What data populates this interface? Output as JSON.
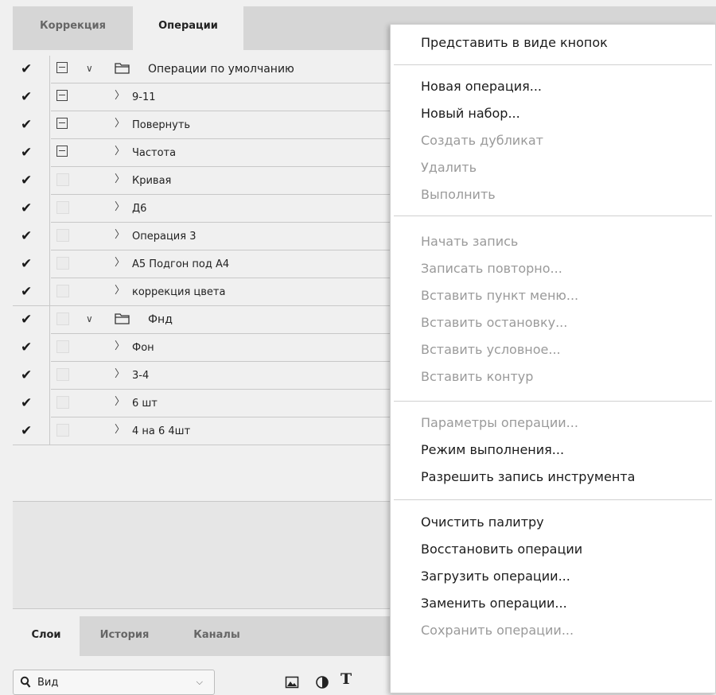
{
  "actions_panel": {
    "tabs": [
      "Коррекция",
      "Операции"
    ],
    "active_tab": 1,
    "sets": [
      {
        "name": "Операции по умолчанию",
        "expanded": true,
        "actions": [
          "9-11",
          "Повернуть",
          "Частота",
          "Кривая",
          "Д6",
          "Операция 3",
          "А5 Подгон под А4",
          "коррекция цвета"
        ]
      },
      {
        "name": "Фнд",
        "expanded": true,
        "actions": [
          "Фон",
          "3-4",
          "6 шт",
          "4 на 6 4шт"
        ]
      }
    ],
    "rows": [
      {
        "label": "Операции по умолчанию",
        "type": "set",
        "check": "✔",
        "dialog": true
      },
      {
        "label": "9-11",
        "type": "action",
        "check": "✔",
        "dialog": true
      },
      {
        "label": "Повернуть",
        "type": "action",
        "check": "✔",
        "dialog": true
      },
      {
        "label": "Частота",
        "type": "action",
        "check": "✔",
        "dialog": true
      },
      {
        "label": "Кривая",
        "type": "action",
        "check": "✔",
        "dialog": false
      },
      {
        "label": "Д6",
        "type": "action",
        "check": "✔",
        "dialog": false
      },
      {
        "label": "Операция 3",
        "type": "action",
        "check": "✔",
        "dialog": false
      },
      {
        "label": "А5 Подгон под А4",
        "type": "action",
        "check": "✔",
        "dialog": false
      },
      {
        "label": "коррекция цвета",
        "type": "action",
        "check": "✔",
        "dialog": false
      },
      {
        "label": "Фнд",
        "type": "set",
        "check": "✔",
        "dialog": false
      },
      {
        "label": "Фон",
        "type": "action",
        "check": "✔",
        "dialog": false
      },
      {
        "label": "3-4",
        "type": "action",
        "check": "✔",
        "dialog": false
      },
      {
        "label": "6 шт",
        "type": "action",
        "check": "✔",
        "dialog": false
      },
      {
        "label": "4 на 6 4шт",
        "type": "action",
        "check": "✔",
        "dialog": false
      }
    ]
  },
  "layers_panel": {
    "tabs": [
      "Слои",
      "История",
      "Каналы"
    ],
    "active_tab": 0,
    "filter": {
      "icon": "search-icon",
      "label": "Вид",
      "dropdown": "⌵"
    },
    "filter_icons": [
      "image-filter-icon",
      "adjustment-filter-icon",
      "type-filter-icon"
    ],
    "type_glyph": "T"
  },
  "context_menu": {
    "items": [
      {
        "label": "Представить в виде кнопок",
        "enabled": true
      },
      {
        "label": "Новая операция...",
        "enabled": true
      },
      {
        "label": "Новый набор...",
        "enabled": true
      },
      {
        "label": "Создать дубликат",
        "enabled": false
      },
      {
        "label": "Удалить",
        "enabled": false
      },
      {
        "label": "Выполнить",
        "enabled": false
      },
      {
        "label": "Начать запись",
        "enabled": false
      },
      {
        "label": "Записать повторно...",
        "enabled": false
      },
      {
        "label": "Вставить пункт меню...",
        "enabled": false
      },
      {
        "label": "Вставить остановку...",
        "enabled": false
      },
      {
        "label": "Вставить условное...",
        "enabled": false
      },
      {
        "label": "Вставить контур",
        "enabled": false
      },
      {
        "label": "Параметры операции...",
        "enabled": false
      },
      {
        "label": "Режим выполнения...",
        "enabled": true
      },
      {
        "label": "Разрешить запись инструмента",
        "enabled": true
      },
      {
        "label": "Очистить палитру",
        "enabled": true
      },
      {
        "label": "Восстановить операции",
        "enabled": true
      },
      {
        "label": "Загрузить операции...",
        "enabled": true
      },
      {
        "label": "Заменить операции...",
        "enabled": true
      },
      {
        "label": "Сохранить операции...",
        "enabled": false
      }
    ]
  }
}
